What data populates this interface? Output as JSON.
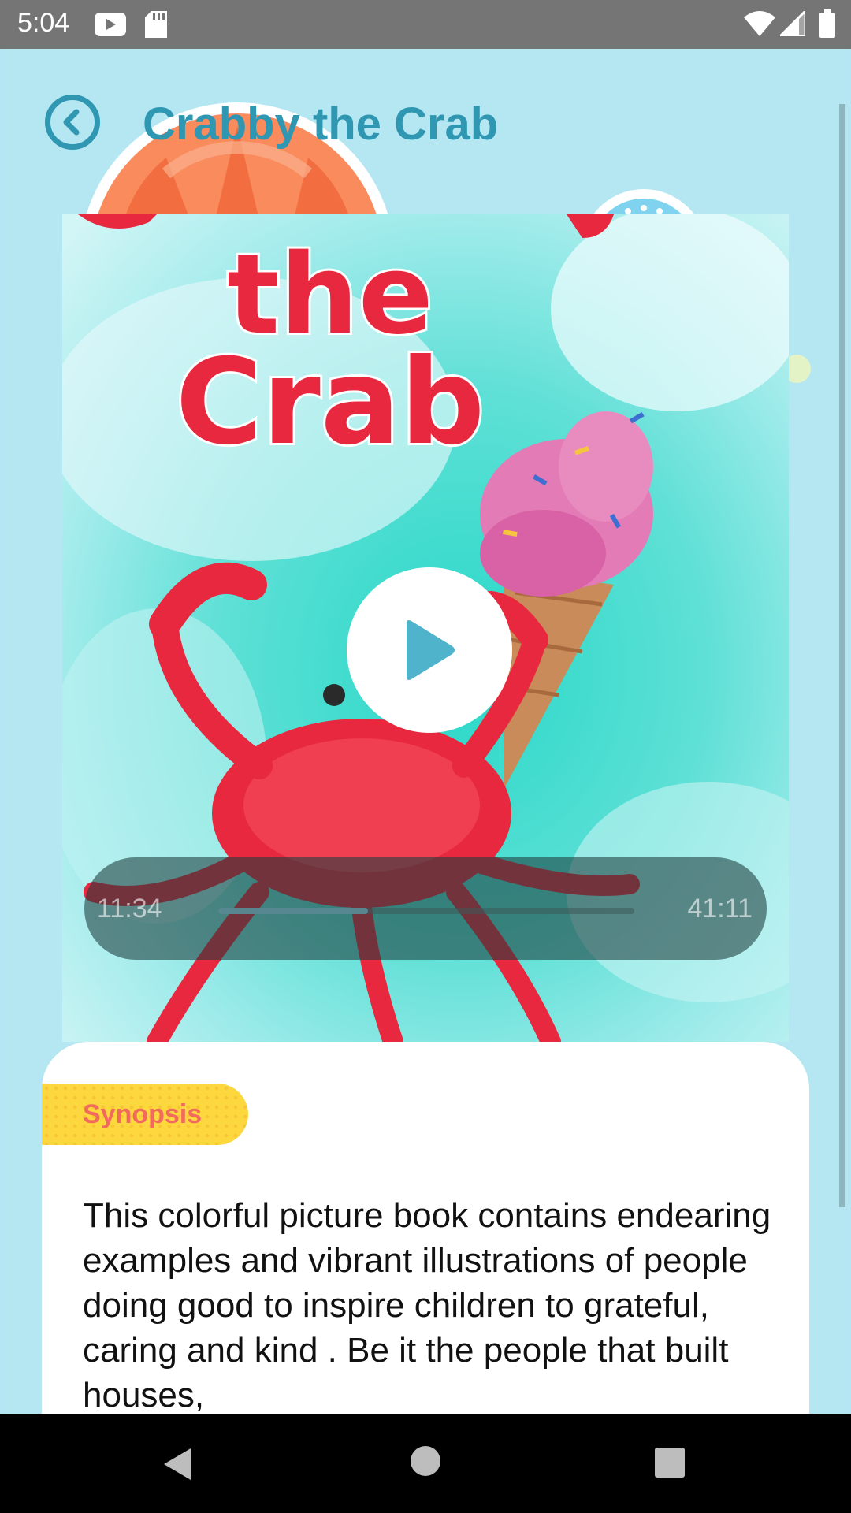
{
  "status_bar": {
    "time": "5:04",
    "icons": [
      "youtube-icon",
      "sd-card-icon",
      "wifi-icon",
      "signal-icon",
      "battery-icon"
    ]
  },
  "header": {
    "title": "Crabby the Crab",
    "back_icon": "chevron-left-circle-icon"
  },
  "cover": {
    "title_lines": [
      "the",
      "Crab"
    ]
  },
  "player": {
    "current_time": "11:34",
    "total_time": "41:11",
    "progress_fraction": 0.36
  },
  "synopsis": {
    "label": "Synopsis",
    "text": "This colorful picture book contains endearing examples and vibrant illustrations of people doing good to inspire children to grateful, caring and kind . Be it the people that built houses,"
  },
  "colors": {
    "background": "#b5e7f3",
    "accent": "#2f97b1",
    "badge": "#fcd83e",
    "badge_text": "#f2695e"
  },
  "nav_bar": {
    "icons": [
      "back-triangle-icon",
      "home-circle-icon",
      "recents-square-icon"
    ]
  }
}
